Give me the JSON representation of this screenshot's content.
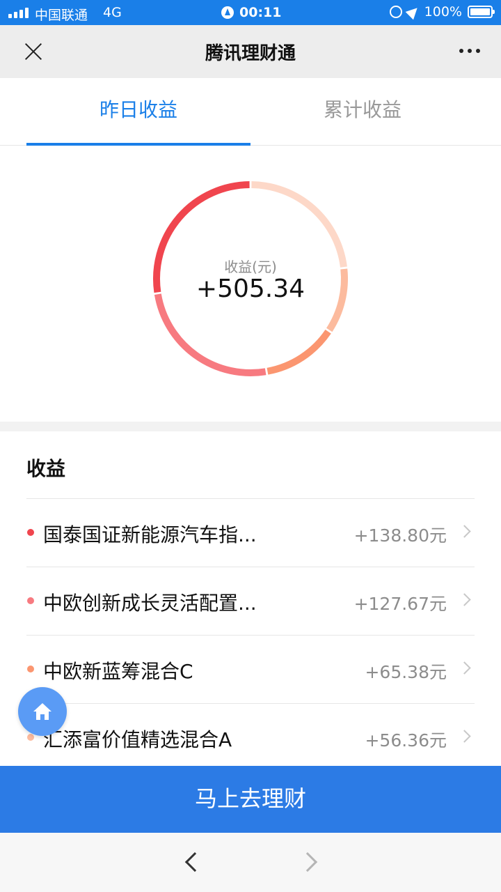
{
  "status_bar": {
    "carrier": "中国联通",
    "network": "4G",
    "time": "00:11",
    "battery": "100%"
  },
  "header": {
    "title": "腾讯理财通"
  },
  "tabs": [
    {
      "label": "昨日收益",
      "active": true
    },
    {
      "label": "累计收益",
      "active": false
    }
  ],
  "summary": {
    "label": "收益(元)",
    "value": "+505.34"
  },
  "earnings": {
    "title": "收益",
    "items": [
      {
        "name": "国泰国证新能源汽车指...",
        "amount": "+138.80元",
        "color": "#f0454e",
        "share": 138.8
      },
      {
        "name": "中欧创新成长灵活配置...",
        "amount": "+127.67元",
        "color": "#f77a80",
        "share": 127.67
      },
      {
        "name": "中欧新蓝筹混合C",
        "amount": "+65.38元",
        "color": "#fb9670",
        "share": 65.38
      },
      {
        "name": "汇添富价值精选混合A",
        "amount": "+56.36元",
        "color": "#fcbb9e",
        "share": 56.36
      }
    ]
  },
  "ring_segments": [
    {
      "share": 117.13,
      "color": "#fdd8c8"
    },
    {
      "share": 56.36,
      "color": "#fcbb9e"
    },
    {
      "share": 65.38,
      "color": "#fb9670"
    },
    {
      "share": 127.67,
      "color": "#f77a80"
    },
    {
      "share": 138.8,
      "color": "#f0454e"
    }
  ],
  "cta": {
    "label": "马上去理财"
  },
  "colors": {
    "accent": "#1a7fe8",
    "cta": "#2c7be5"
  }
}
